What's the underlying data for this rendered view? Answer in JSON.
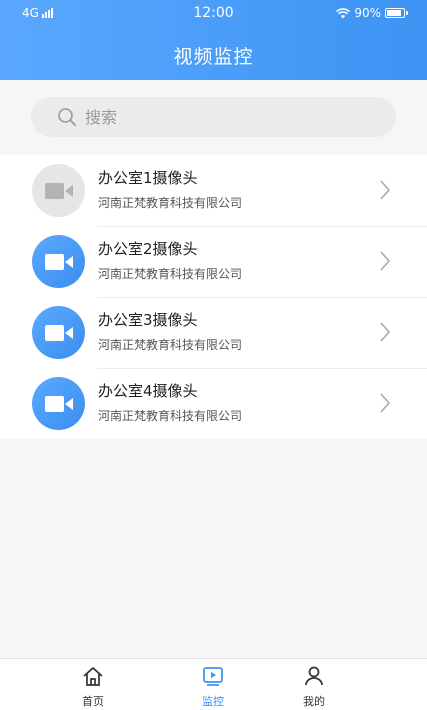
{
  "status": {
    "network": "4G",
    "time": "12:00",
    "battery": "90%",
    "battery_level": 0.9
  },
  "header": {
    "title": "视频监控"
  },
  "search": {
    "placeholder": "搜索"
  },
  "cameras": [
    {
      "name": "办公室1摄像头",
      "company": "河南正梵教育科技有限公司",
      "active": false
    },
    {
      "name": "办公室2摄像头",
      "company": "河南正梵教育科技有限公司",
      "active": true
    },
    {
      "name": "办公室3摄像头",
      "company": "河南正梵教育科技有限公司",
      "active": true
    },
    {
      "name": "办公室4摄像头",
      "company": "河南正梵教育科技有限公司",
      "active": true
    }
  ],
  "tabs": [
    {
      "label": "首页",
      "icon": "home-icon"
    },
    {
      "label": "监控",
      "icon": "video-icon",
      "selected": true
    },
    {
      "label": "我的",
      "icon": "user-icon"
    }
  ],
  "colors": {
    "accent": "#3c93f2",
    "inactive_icon": "#e6e6e6"
  }
}
